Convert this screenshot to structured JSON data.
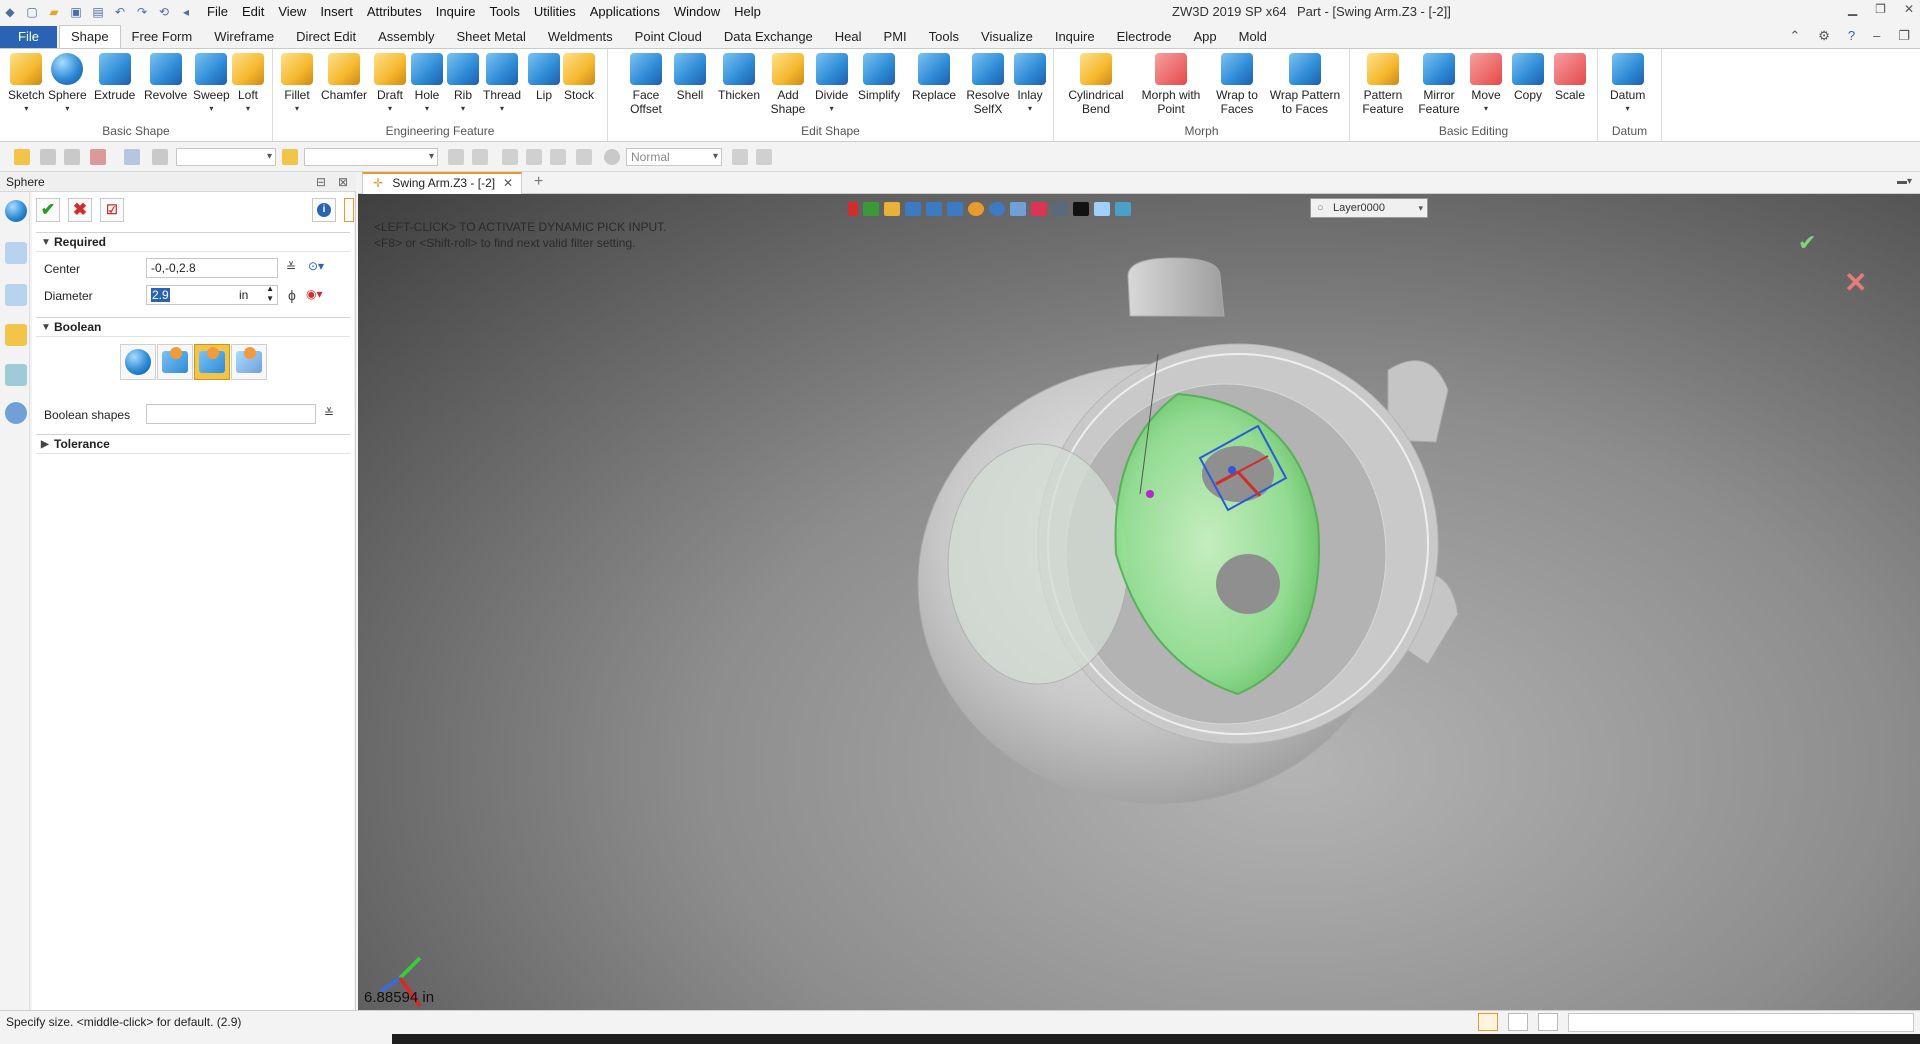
{
  "titlebar": {
    "menu": [
      "File",
      "Edit",
      "View",
      "Insert",
      "Attributes",
      "Inquire",
      "Tools",
      "Utilities",
      "Applications",
      "Window",
      "Help"
    ],
    "app_name": "ZW3D 2019 SP x64",
    "doc_title": "Part - [Swing Arm.Z3 - [-2]]"
  },
  "ribbon_tabs": [
    "File",
    "Shape",
    "Free Form",
    "Wireframe",
    "Direct Edit",
    "Assembly",
    "Sheet Metal",
    "Weldments",
    "Point Cloud",
    "Data Exchange",
    "Heal",
    "PMI",
    "Tools",
    "Visualize",
    "Inquire",
    "Electrode",
    "App",
    "Mold"
  ],
  "ribbon": {
    "basic_shape": {
      "label": "Basic Shape",
      "buttons": [
        "Sketch",
        "Sphere",
        "Extrude",
        "Revolve",
        "Sweep",
        "Loft"
      ]
    },
    "engineering_feature": {
      "label": "Engineering Feature",
      "buttons": [
        "Fillet",
        "Chamfer",
        "Draft",
        "Hole",
        "Rib",
        "Thread",
        "Lip",
        "Stock"
      ]
    },
    "edit_shape": {
      "label": "Edit Shape",
      "buttons": [
        "Face Offset",
        "Shell",
        "Thicken",
        "Add Shape",
        "Divide",
        "Simplify",
        "Replace",
        "Resolve SelfX",
        "Inlay"
      ]
    },
    "morph": {
      "label": "Morph",
      "buttons": [
        "Cylindrical Bend",
        "Morph with Point",
        "Wrap to Faces",
        "Wrap Pattern to Faces"
      ]
    },
    "basic_editing": {
      "label": "Basic Editing",
      "buttons": [
        "Pattern Feature",
        "Mirror Feature",
        "Move",
        "Copy",
        "Scale"
      ]
    },
    "datum": {
      "label": "Datum",
      "buttons": [
        "Datum"
      ]
    }
  },
  "toolbar": {
    "mode_combo": "Normal"
  },
  "panel": {
    "title": "Sphere",
    "required_label": "Required",
    "center_label": "Center",
    "center_value": "-0,-0,2.8",
    "diameter_label": "Diameter",
    "diameter_value": "2.9",
    "diameter_unit": "in",
    "boolean_label": "Boolean",
    "boolean_shapes_label": "Boolean shapes",
    "boolean_shapes_value": "",
    "tolerance_label": "Tolerance"
  },
  "doc_tab": {
    "label": "Swing Arm.Z3 - [-2]"
  },
  "viewport": {
    "message1": "<LEFT-CLICK> TO ACTIVATE DYNAMIC PICK INPUT.",
    "message2": "<F8> or <Shift-roll> to find next valid filter setting.",
    "layer": "Layer0000",
    "measure": "6.88594 in"
  },
  "status": {
    "text": "Specify size.  <middle-click> for default. (2.9)"
  },
  "colors": {
    "file_tab": "#2b63b4",
    "accent_orange": "#e59a2e",
    "preview_green": "#8fe08f",
    "ok_green": "#1fa01f",
    "cancel_red": "#d22c2c"
  },
  "icons": {
    "ok": "check-icon",
    "cancel": "close-icon",
    "apply": "apply-icon",
    "info": "info-icon"
  }
}
